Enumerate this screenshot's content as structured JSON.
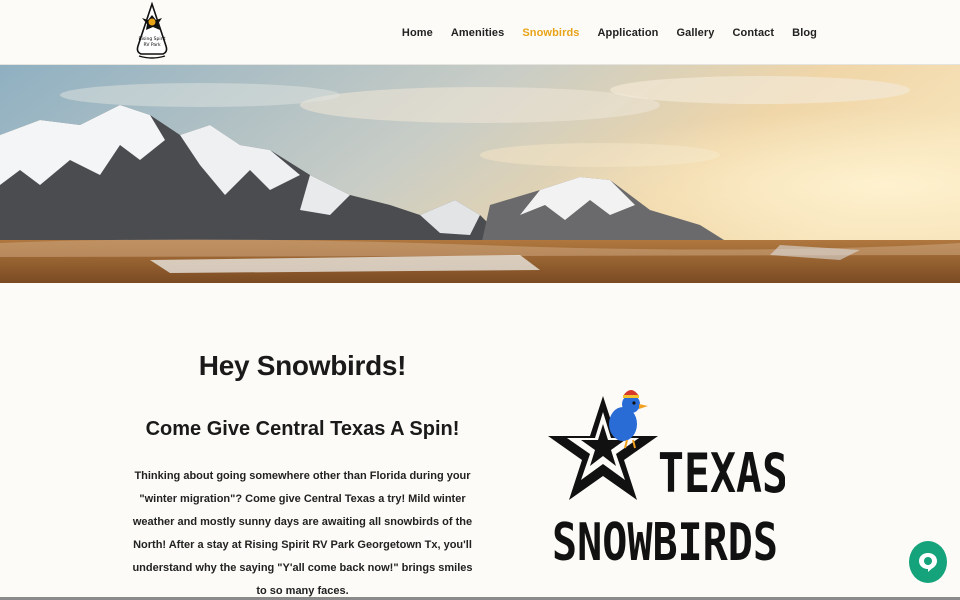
{
  "nav": {
    "items": [
      {
        "label": "Home",
        "active": false
      },
      {
        "label": "Amenities",
        "active": false
      },
      {
        "label": "Snowbirds",
        "active": true
      },
      {
        "label": "Application",
        "active": false
      },
      {
        "label": "Gallery",
        "active": false
      },
      {
        "label": "Contact",
        "active": false
      },
      {
        "label": "Blog",
        "active": false
      }
    ],
    "active_color": "#e8a317"
  },
  "logo": {
    "icon": "eagle-arrowhead-logo",
    "text_line1": "Rising Spirit",
    "text_line2": "RV Park"
  },
  "hero": {
    "image": "snowy-mountains-sunset"
  },
  "content": {
    "heading": "Hey Snowbirds!",
    "subheading": "Come Give Central Texas A Spin!",
    "paragraph": "Thinking about going somewhere other than Florida during your \"winter migration\"? Come give Central Texas a try! Mild winter weather and mostly sunny days are awaiting all snowbirds of the North! After a stay at Rising Spirit RV Park Georgetown Tx, you'll understand why the saying \"Y'all come back now!\" brings smiles to so many faces."
  },
  "texas_logo": {
    "line1": "TEXAS",
    "line2": "SNOWBIRDS",
    "icon": "star-bluebird-logo"
  },
  "chat": {
    "icon": "chat-bubble-icon",
    "color": "#14a37a"
  }
}
